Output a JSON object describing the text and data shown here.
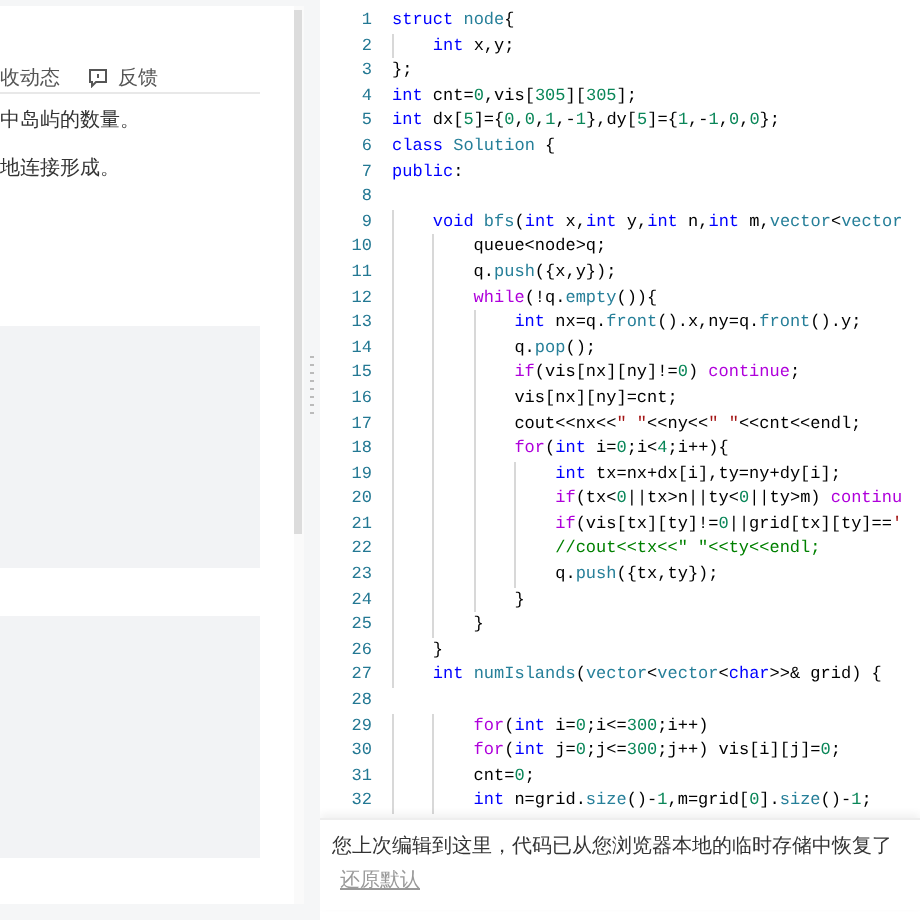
{
  "article": {
    "toolbar": [
      {
        "kind": "text",
        "label": "收动态"
      },
      {
        "kind": "icon-text",
        "label": "反馈"
      }
    ],
    "paragraphs": [
      "中岛屿的数量。",
      "地连接形成。"
    ]
  },
  "editor": {
    "lines": [
      {
        "number": "1",
        "tokens": [
          {
            "text": "struct ",
            "kind": "kw"
          },
          {
            "text": "node",
            "kind": "ty"
          },
          {
            "text": "{",
            "kind": "plain"
          }
        ]
      },
      {
        "number": "2",
        "tokens": [
          {
            "text": "    int",
            "kind": "kw"
          },
          {
            "text": " x,y;",
            "kind": "plain"
          }
        ]
      },
      {
        "number": "3",
        "tokens": [
          {
            "text": "};",
            "kind": "plain"
          }
        ]
      },
      {
        "number": "4",
        "tokens": [
          {
            "text": "int",
            "kind": "kw"
          },
          {
            "text": " cnt=",
            "kind": "plain"
          },
          {
            "text": "0",
            "kind": "num"
          },
          {
            "text": ",vis[",
            "kind": "plain"
          },
          {
            "text": "305",
            "kind": "num"
          },
          {
            "text": "][",
            "kind": "plain"
          },
          {
            "text": "305",
            "kind": "num"
          },
          {
            "text": "];",
            "kind": "plain"
          }
        ]
      },
      {
        "number": "5",
        "tokens": [
          {
            "text": "int",
            "kind": "kw"
          },
          {
            "text": " dx[",
            "kind": "plain"
          },
          {
            "text": "5",
            "kind": "num"
          },
          {
            "text": "]={",
            "kind": "plain"
          },
          {
            "text": "0",
            "kind": "num"
          },
          {
            "text": ",",
            "kind": "plain"
          },
          {
            "text": "0",
            "kind": "num"
          },
          {
            "text": ",",
            "kind": "plain"
          },
          {
            "text": "1",
            "kind": "num"
          },
          {
            "text": ",-",
            "kind": "plain"
          },
          {
            "text": "1",
            "kind": "num"
          },
          {
            "text": "},dy[",
            "kind": "plain"
          },
          {
            "text": "5",
            "kind": "num"
          },
          {
            "text": "]={",
            "kind": "plain"
          },
          {
            "text": "1",
            "kind": "num"
          },
          {
            "text": ",-",
            "kind": "plain"
          },
          {
            "text": "1",
            "kind": "num"
          },
          {
            "text": ",",
            "kind": "plain"
          },
          {
            "text": "0",
            "kind": "num"
          },
          {
            "text": ",",
            "kind": "plain"
          },
          {
            "text": "0",
            "kind": "num"
          },
          {
            "text": "};",
            "kind": "plain"
          }
        ]
      },
      {
        "number": "6",
        "tokens": [
          {
            "text": "class ",
            "kind": "kw"
          },
          {
            "text": "Solution",
            "kind": "ty"
          },
          {
            "text": " {",
            "kind": "plain"
          }
        ]
      },
      {
        "number": "7",
        "tokens": [
          {
            "text": "public",
            "kind": "kw"
          },
          {
            "text": ":",
            "kind": "plain"
          }
        ]
      },
      {
        "number": "8"
      },
      {
        "number": "9",
        "tokens": [
          {
            "text": "    void ",
            "kind": "kw"
          },
          {
            "text": "bfs",
            "kind": "fn"
          },
          {
            "text": "(",
            "kind": "plain"
          },
          {
            "text": "int",
            "kind": "kw"
          },
          {
            "text": " x,",
            "kind": "plain"
          },
          {
            "text": "int",
            "kind": "kw"
          },
          {
            "text": " y,",
            "kind": "plain"
          },
          {
            "text": "int",
            "kind": "kw"
          },
          {
            "text": " n,",
            "kind": "plain"
          },
          {
            "text": "int",
            "kind": "kw"
          },
          {
            "text": " m,",
            "kind": "plain"
          },
          {
            "text": "vector",
            "kind": "ty"
          },
          {
            "text": "<",
            "kind": "plain"
          },
          {
            "text": "vector",
            "kind": "ty"
          }
        ]
      },
      {
        "number": "10",
        "tokens": [
          {
            "text": "        queue<node>q;",
            "kind": "plain"
          }
        ]
      },
      {
        "number": "11",
        "tokens": [
          {
            "text": "        q.",
            "kind": "plain"
          },
          {
            "text": "push",
            "kind": "fn"
          },
          {
            "text": "({x,y});",
            "kind": "plain"
          }
        ]
      },
      {
        "number": "12",
        "tokens": [
          {
            "text": "        while",
            "kind": "ctl"
          },
          {
            "text": "(!q.",
            "kind": "plain"
          },
          {
            "text": "empty",
            "kind": "fn"
          },
          {
            "text": "()){",
            "kind": "plain"
          }
        ]
      },
      {
        "number": "13",
        "tokens": [
          {
            "text": "            int",
            "kind": "kw"
          },
          {
            "text": " nx=q.",
            "kind": "plain"
          },
          {
            "text": "front",
            "kind": "fn"
          },
          {
            "text": "().x,ny=q.",
            "kind": "plain"
          },
          {
            "text": "front",
            "kind": "fn"
          },
          {
            "text": "().y;",
            "kind": "plain"
          }
        ]
      },
      {
        "number": "14",
        "tokens": [
          {
            "text": "            q.",
            "kind": "plain"
          },
          {
            "text": "pop",
            "kind": "fn"
          },
          {
            "text": "();",
            "kind": "plain"
          }
        ]
      },
      {
        "number": "15",
        "tokens": [
          {
            "text": "            if",
            "kind": "ctl"
          },
          {
            "text": "(vis[nx][ny]!=",
            "kind": "plain"
          },
          {
            "text": "0",
            "kind": "num"
          },
          {
            "text": ") ",
            "kind": "plain"
          },
          {
            "text": "continue",
            "kind": "ctl"
          },
          {
            "text": ";",
            "kind": "plain"
          }
        ]
      },
      {
        "number": "16",
        "tokens": [
          {
            "text": "            vis[nx][ny]=cnt;",
            "kind": "plain"
          }
        ]
      },
      {
        "number": "17",
        "tokens": [
          {
            "text": "            cout<<nx<<",
            "kind": "plain"
          },
          {
            "text": "\" \"",
            "kind": "str"
          },
          {
            "text": "<<ny<<",
            "kind": "plain"
          },
          {
            "text": "\" \"",
            "kind": "str"
          },
          {
            "text": "<<cnt<<endl;",
            "kind": "plain"
          }
        ]
      },
      {
        "number": "18",
        "tokens": [
          {
            "text": "            for",
            "kind": "ctl"
          },
          {
            "text": "(",
            "kind": "plain"
          },
          {
            "text": "int",
            "kind": "kw"
          },
          {
            "text": " i=",
            "kind": "plain"
          },
          {
            "text": "0",
            "kind": "num"
          },
          {
            "text": ";i<",
            "kind": "plain"
          },
          {
            "text": "4",
            "kind": "num"
          },
          {
            "text": ";i++){",
            "kind": "plain"
          }
        ]
      },
      {
        "number": "19",
        "tokens": [
          {
            "text": "                int",
            "kind": "kw"
          },
          {
            "text": " tx=nx+dx[i],ty=ny+dy[i];",
            "kind": "plain"
          }
        ]
      },
      {
        "number": "20",
        "tokens": [
          {
            "text": "                if",
            "kind": "ctl"
          },
          {
            "text": "(tx<",
            "kind": "plain"
          },
          {
            "text": "0",
            "kind": "num"
          },
          {
            "text": "||tx>n||ty<",
            "kind": "plain"
          },
          {
            "text": "0",
            "kind": "num"
          },
          {
            "text": "||ty>m) ",
            "kind": "plain"
          },
          {
            "text": "continu",
            "kind": "ctl"
          }
        ]
      },
      {
        "number": "21",
        "tokens": [
          {
            "text": "                if",
            "kind": "ctl"
          },
          {
            "text": "(vis[tx][ty]!=",
            "kind": "plain"
          },
          {
            "text": "0",
            "kind": "num"
          },
          {
            "text": "||grid[tx][ty]==",
            "kind": "plain"
          },
          {
            "text": "'",
            "kind": "str"
          }
        ]
      },
      {
        "number": "22",
        "tokens": [
          {
            "text": "                //cout<<tx<<\" \"<<ty<<endl;",
            "kind": "cmt"
          }
        ]
      },
      {
        "number": "23",
        "tokens": [
          {
            "text": "                q.",
            "kind": "plain"
          },
          {
            "text": "push",
            "kind": "fn"
          },
          {
            "text": "({tx,ty});",
            "kind": "plain"
          }
        ]
      },
      {
        "number": "24",
        "tokens": [
          {
            "text": "            }",
            "kind": "plain"
          }
        ]
      },
      {
        "number": "25",
        "tokens": [
          {
            "text": "        }",
            "kind": "plain"
          }
        ]
      },
      {
        "number": "26",
        "tokens": [
          {
            "text": "    }",
            "kind": "plain"
          }
        ]
      },
      {
        "number": "27",
        "tokens": [
          {
            "text": "    int ",
            "kind": "kw"
          },
          {
            "text": "numIslands",
            "kind": "fn"
          },
          {
            "text": "(",
            "kind": "plain"
          },
          {
            "text": "vector",
            "kind": "ty"
          },
          {
            "text": "<",
            "kind": "plain"
          },
          {
            "text": "vector",
            "kind": "ty"
          },
          {
            "text": "<",
            "kind": "plain"
          },
          {
            "text": "char",
            "kind": "kw"
          },
          {
            "text": ">>& grid) {",
            "kind": "plain"
          }
        ]
      },
      {
        "number": "28"
      },
      {
        "number": "29",
        "tokens": [
          {
            "text": "        for",
            "kind": "ctl"
          },
          {
            "text": "(",
            "kind": "plain"
          },
          {
            "text": "int",
            "kind": "kw"
          },
          {
            "text": " i=",
            "kind": "plain"
          },
          {
            "text": "0",
            "kind": "num"
          },
          {
            "text": ";i<=",
            "kind": "plain"
          },
          {
            "text": "300",
            "kind": "num"
          },
          {
            "text": ";i++)",
            "kind": "plain"
          }
        ]
      },
      {
        "number": "30",
        "tokens": [
          {
            "text": "        for",
            "kind": "ctl"
          },
          {
            "text": "(",
            "kind": "plain"
          },
          {
            "text": "int",
            "kind": "kw"
          },
          {
            "text": " j=",
            "kind": "plain"
          },
          {
            "text": "0",
            "kind": "num"
          },
          {
            "text": ";j<=",
            "kind": "plain"
          },
          {
            "text": "300",
            "kind": "num"
          },
          {
            "text": ";j++) vis[i][j]=",
            "kind": "plain"
          },
          {
            "text": "0",
            "kind": "num"
          },
          {
            "text": ";",
            "kind": "plain"
          }
        ]
      },
      {
        "number": "31",
        "tokens": [
          {
            "text": "        cnt=",
            "kind": "plain"
          },
          {
            "text": "0",
            "kind": "num"
          },
          {
            "text": ";",
            "kind": "plain"
          }
        ]
      },
      {
        "number": "32",
        "tokens": [
          {
            "text": "        int",
            "kind": "kw"
          },
          {
            "text": " n=grid.",
            "kind": "plain"
          },
          {
            "text": "size",
            "kind": "fn"
          },
          {
            "text": "()-",
            "kind": "plain"
          },
          {
            "text": "1",
            "kind": "num"
          },
          {
            "text": ",m=grid[",
            "kind": "plain"
          },
          {
            "text": "0",
            "kind": "num"
          },
          {
            "text": "].",
            "kind": "plain"
          },
          {
            "text": "size",
            "kind": "fn"
          },
          {
            "text": "()-",
            "kind": "plain"
          },
          {
            "text": "1",
            "kind": "num"
          },
          {
            "text": ";",
            "kind": "plain"
          }
        ]
      }
    ]
  },
  "restore_bar": {
    "message": "您上次编辑到这里，代码已从您浏览器本地的临时存储中恢复了",
    "link": "还原默认"
  }
}
